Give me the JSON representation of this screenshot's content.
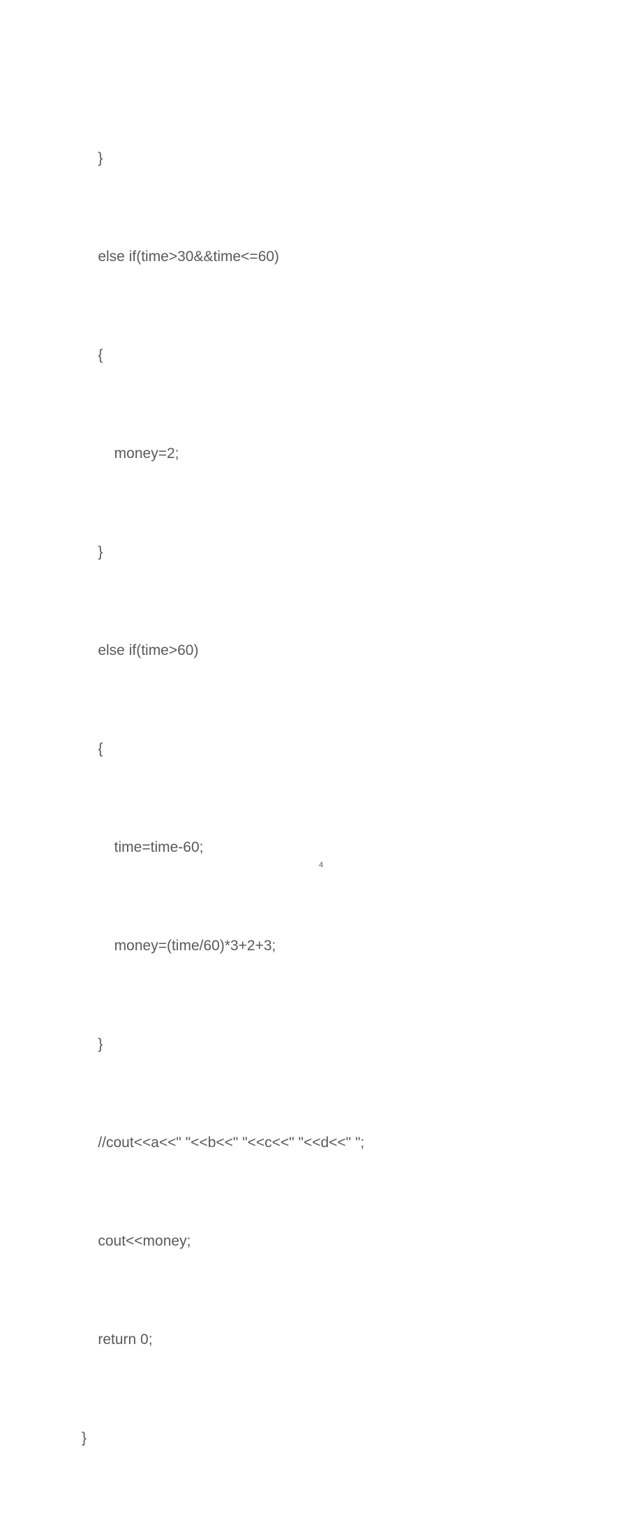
{
  "code": {
    "lines": [
      "    }",
      "    else if(time>30&&time<=60)",
      "    {",
      "        money=2;",
      "    }",
      "    else if(time>60)",
      "    {",
      "        time=time-60;",
      "        money=(time/60)*3+2+3;",
      "    }",
      "    //cout<<a<<\" \"<<b<<\" \"<<c<<\" \"<<d<<\" \";",
      "    cout<<money;",
      "    return 0;",
      "}"
    ]
  },
  "page_number": "4"
}
